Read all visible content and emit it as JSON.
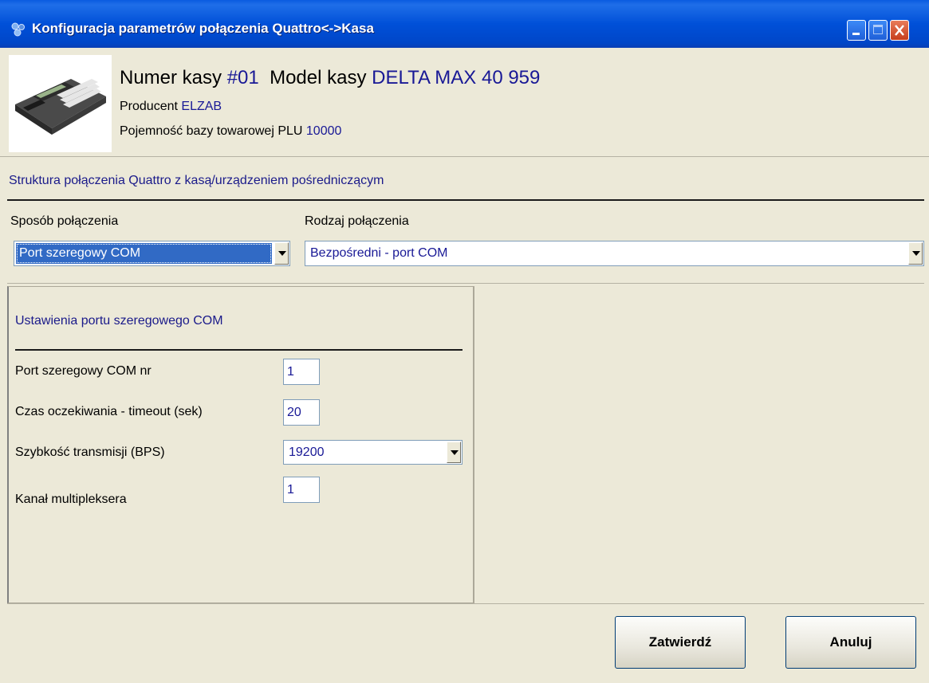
{
  "window": {
    "title": "Konfiguracja parametrów połączenia Quattro<->Kasa",
    "icon": "app-gears-icon",
    "controls": [
      "minimize-icon",
      "maximize-icon",
      "close-icon"
    ]
  },
  "device": {
    "image": "cash-register-image",
    "numer_label": "Numer kasy",
    "numer_value": "#01",
    "model_label": "Model kasy",
    "model_value": "DELTA MAX 40 959",
    "producent_label": "Producent",
    "producent_value": "ELZAB",
    "plu_label": "Pojemność bazy towarowej PLU",
    "plu_value": "10000"
  },
  "structure": {
    "heading": "Struktura połączenia Quattro z kasą/urządzeniem pośredniczącym",
    "sposob_label": "Sposób połączenia",
    "sposob_value": "Port szeregowy COM",
    "rodzaj_label": "Rodzaj połączenia",
    "rodzaj_value": "Bezpośredni - port COM"
  },
  "com_settings": {
    "heading": "Ustawienia portu szeregowego COM",
    "port_label": "Port szeregowy COM nr",
    "port_value": "1",
    "timeout_label": "Czas oczekiwania - timeout (sek)",
    "timeout_value": "20",
    "speed_label": "Szybkość transmisji (BPS)",
    "speed_value": "19200",
    "mux_label": "Kanał multipleksera",
    "mux_value": "1"
  },
  "buttons": {
    "confirm": "Zatwierdź",
    "cancel": "Anuluj"
  },
  "colors": {
    "titlebar": "#0050d8",
    "value_text": "#191996",
    "selection": "#316ac5",
    "window_bg": "#ece9d8"
  }
}
